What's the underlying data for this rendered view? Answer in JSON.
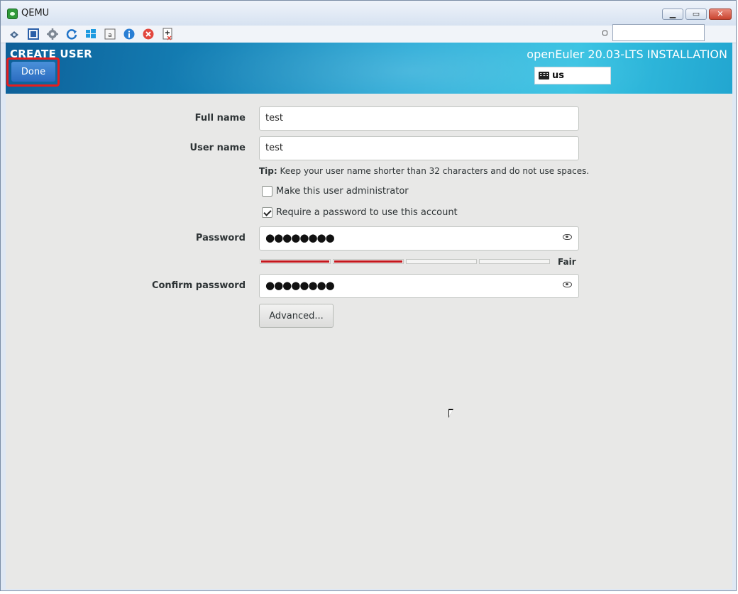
{
  "window": {
    "title": "QEMU",
    "minimize_glyph": "▁",
    "maximize_glyph": "▭",
    "close_glyph": "✕"
  },
  "toolbar": {
    "icons": [
      "network-icon",
      "fullscreen-icon",
      "settings-icon",
      "refresh-icon",
      "windows-icon",
      "keyboard-a-icon",
      "info-icon",
      "stop-icon",
      "screenshot-icon"
    ],
    "search_value": ""
  },
  "installer": {
    "section_title": "CREATE USER",
    "done_label": "Done",
    "product_title": "openEuler 20.03-LTS INSTALLATION",
    "keyboard_layout": "us"
  },
  "form": {
    "full_name_label": "Full name",
    "full_name_value": "test",
    "user_name_label": "User name",
    "user_name_value": "test",
    "tip_prefix": "Tip:",
    "tip_text": " Keep your user name shorter than 32 characters and do not use spaces.",
    "admin_checkbox_label": "Make this user administrator",
    "admin_checked": false,
    "require_password_label": "Require a password to use this account",
    "require_password_checked": true,
    "password_label": "Password",
    "password_value": "●●●●●●●●",
    "strength_label": "Fair",
    "strength_level": 0.5,
    "confirm_password_label": "Confirm password",
    "confirm_password_value": "●●●●●●●●",
    "advanced_label": "Advanced..."
  },
  "colors": {
    "banner_accent": "#1a8fc4",
    "done_button": "#3a7fd0",
    "strength_bar": "#c4161c",
    "highlight_outline": "#e51d1d"
  }
}
